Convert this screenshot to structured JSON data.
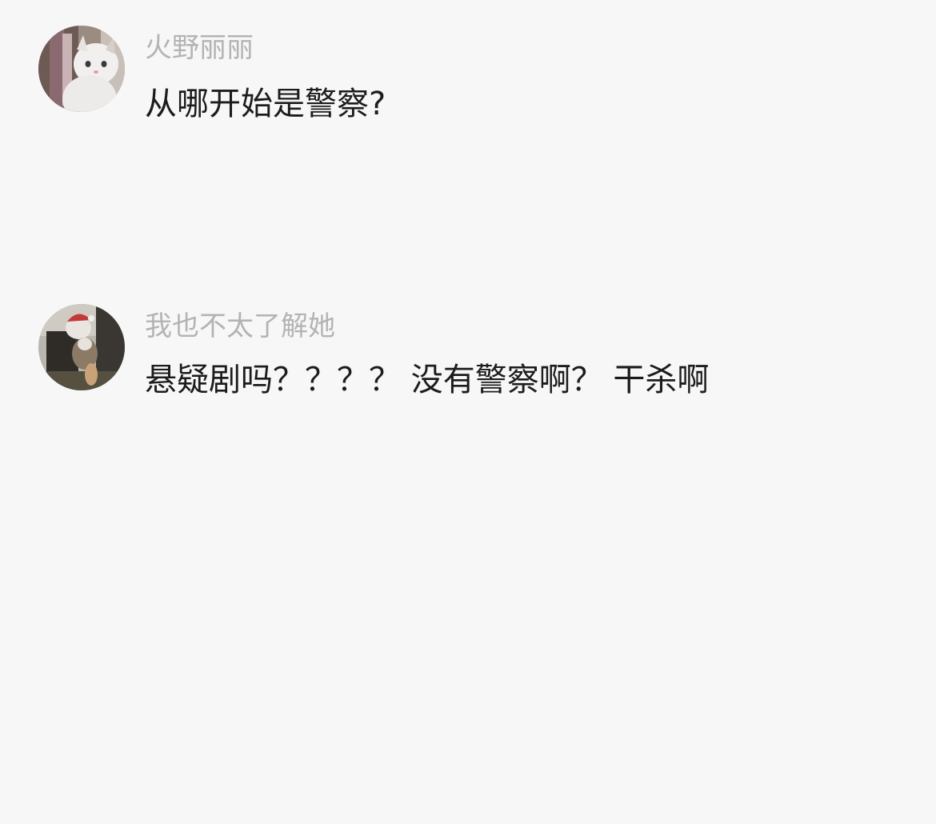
{
  "comments": [
    {
      "username": "火野丽丽",
      "message": "从哪开始是警察?"
    },
    {
      "username": "我也不太了解她",
      "message": "悬疑剧吗？？？？ 没有警察啊？ 干杀啊"
    }
  ]
}
